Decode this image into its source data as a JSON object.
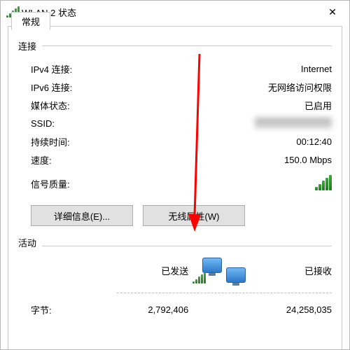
{
  "window": {
    "title": "WLAN 2 状态",
    "close": "✕"
  },
  "tabs": {
    "general": "常规"
  },
  "section": {
    "connection": "连接",
    "signal_quality": "信号质量:",
    "activity": "活动"
  },
  "rows": {
    "ipv4_label": "IPv4 连接:",
    "ipv4_value": "Internet",
    "ipv6_label": "IPv6 连接:",
    "ipv6_value": "无网络访问权限",
    "media_label": "媒体状态:",
    "media_value": "已启用",
    "ssid_label": "SSID:",
    "duration_label": "持续时间:",
    "duration_value": "00:12:40",
    "speed_label": "速度:",
    "speed_value": "150.0 Mbps"
  },
  "buttons": {
    "details": "详细信息(E)...",
    "wireless_props": "无线属性(W)"
  },
  "activity": {
    "sent": "已发送",
    "received": "已接收",
    "bytes_label": "字节:",
    "bytes_sent": "2,792,406",
    "bytes_received": "24,258,035"
  },
  "annotation": {
    "color": "#ff0000"
  }
}
